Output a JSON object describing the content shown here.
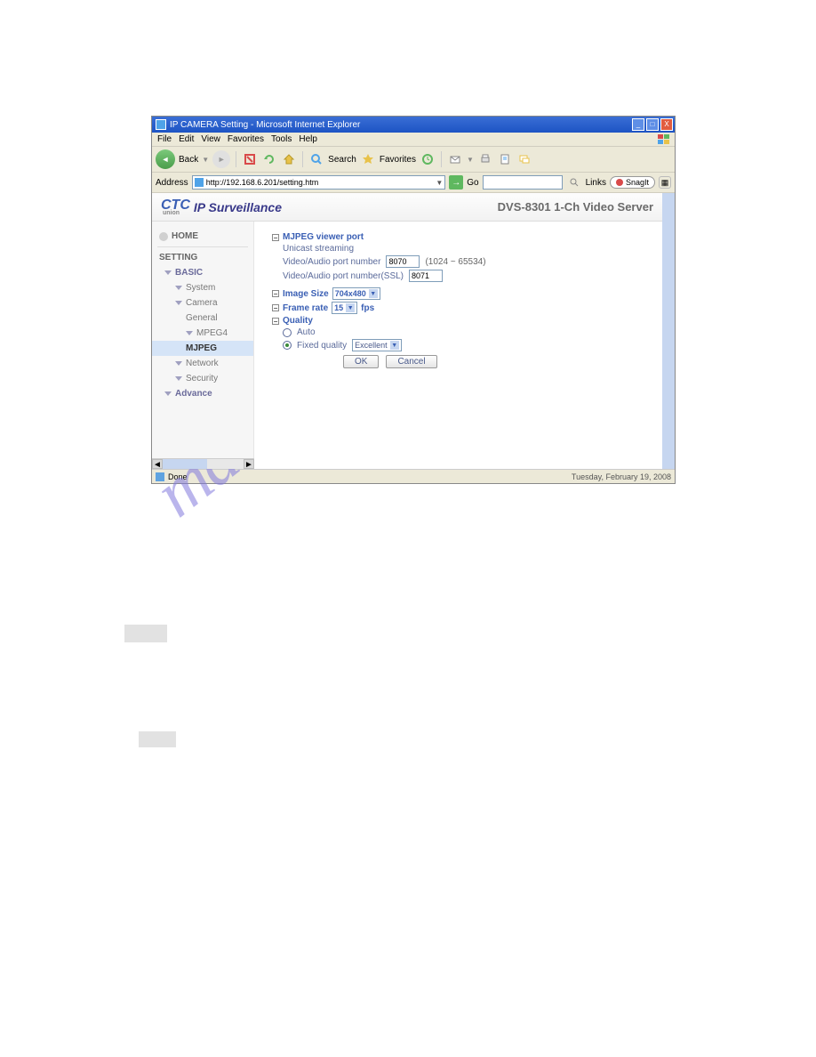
{
  "window": {
    "title": "IP CAMERA Setting - Microsoft Internet Explorer",
    "minimize": "_",
    "maximize": "□",
    "close": "X"
  },
  "menu": {
    "file": "File",
    "edit": "Edit",
    "view": "View",
    "favorites": "Favorites",
    "tools": "Tools",
    "help": "Help"
  },
  "toolbar": {
    "back": "Back",
    "search": "Search",
    "favorites": "Favorites"
  },
  "address": {
    "label": "Address",
    "value": "http://192.168.6.201/setting.htm",
    "go": "Go",
    "links": "Links",
    "snagit": "SnagIt"
  },
  "header": {
    "logo": "CTC",
    "logosub": "union",
    "brand": "IP Surveillance",
    "product": "DVS-8301 1-Ch Video Server"
  },
  "sidebar": {
    "home": "HOME",
    "setting": "SETTING",
    "basic": "BASIC",
    "system": "System",
    "camera": "Camera",
    "general": "General",
    "mpeg4": "MPEG4",
    "mjpeg": "MJPEG",
    "network": "Network",
    "security": "Security",
    "advance": "Advance"
  },
  "content": {
    "mjpeg_port": "MJPEG viewer port",
    "unicast": "Unicast streaming",
    "va_port": "Video/Audio port number",
    "va_port_value": "8070",
    "va_port_hint": "(1024 ~ 65534)",
    "va_port_ssl": "Video/Audio port number(SSL)",
    "va_port_ssl_value": "8071",
    "image_size": "Image Size",
    "image_size_value": "704x480",
    "frame_rate": "Frame rate",
    "frame_rate_value": "15",
    "fps": "fps",
    "quality": "Quality",
    "auto": "Auto",
    "fixed": "Fixed quality",
    "fixed_value": "Excellent",
    "ok": "OK",
    "cancel": "Cancel"
  },
  "status": {
    "done": "Done",
    "date": "Tuesday, February 19, 2008"
  },
  "watermark": "manualshive.com"
}
